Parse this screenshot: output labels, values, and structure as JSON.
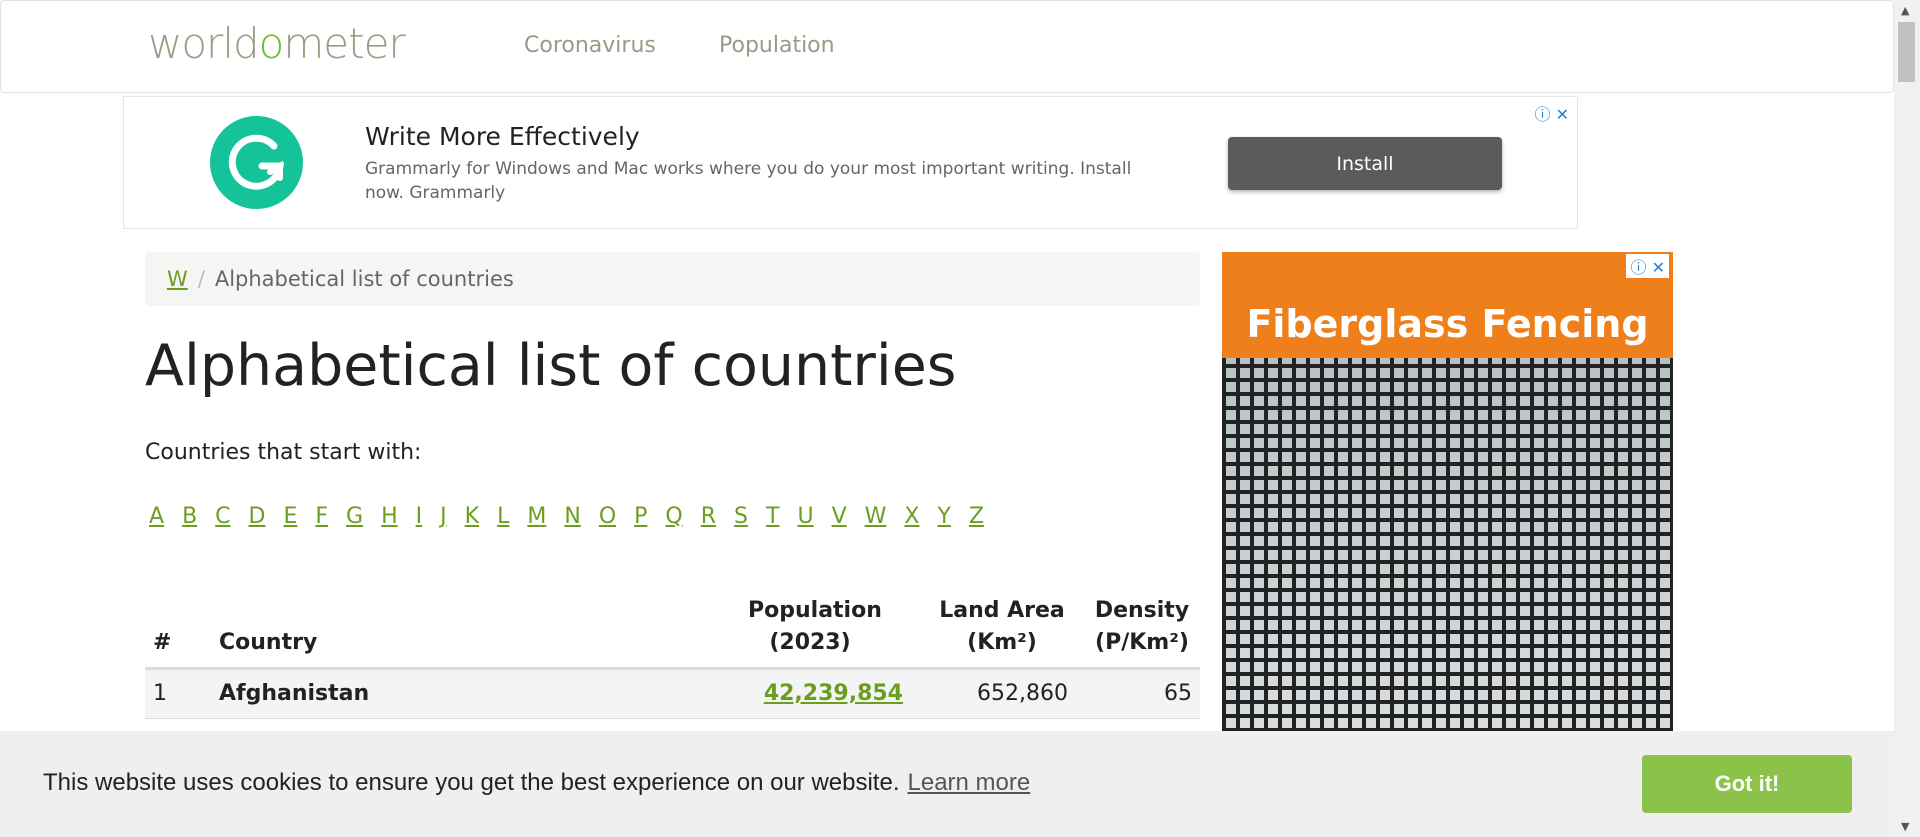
{
  "header": {
    "logo_parts": [
      "world",
      "o",
      "meter"
    ],
    "nav": [
      "Coronavirus",
      "Population"
    ]
  },
  "top_ad": {
    "title": "Write More Effectively",
    "body": "Grammarly for Windows and Mac works where you do your most important writing. Install now. Grammarly",
    "button": "Install",
    "info_icon": "ⓘ",
    "close_icon": "✕"
  },
  "breadcrumb": {
    "home": "W",
    "separator": "/",
    "current": "Alphabetical list of countries"
  },
  "page_title": "Alphabetical list of countries",
  "intro": "Countries that start with:",
  "letters": [
    "A",
    "B",
    "C",
    "D",
    "E",
    "F",
    "G",
    "H",
    "I",
    "J",
    "K",
    "L",
    "M",
    "N",
    "O",
    "P",
    "Q",
    "R",
    "S",
    "T",
    "U",
    "V",
    "W",
    "X",
    "Y",
    "Z"
  ],
  "table": {
    "headers": {
      "num": "#",
      "country": "Country",
      "population_1": "Population",
      "population_2": "(2023)",
      "land_1": "Land Area",
      "land_2": "(Km²)",
      "density_1": "Density",
      "density_2": "(P/Km²)"
    },
    "rows": [
      {
        "num": "1",
        "country": "Afghanistan",
        "population": "42,239,854",
        "land_area": "652,860",
        "density": "65"
      }
    ]
  },
  "side_ad": {
    "title": "Fiberglass Fencing",
    "info_icon": "ⓘ",
    "close_icon": "✕"
  },
  "cookie": {
    "text": "This website uses cookies to ensure you get the best experience on our website.",
    "learn_more": "Learn more",
    "button": "Got it!"
  }
}
